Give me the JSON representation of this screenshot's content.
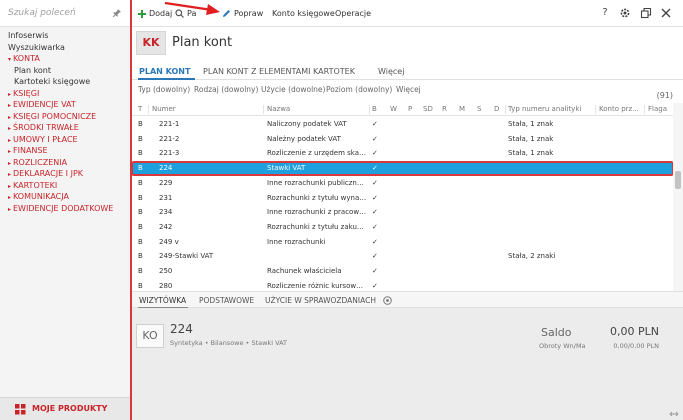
{
  "sidebar": {
    "search_placeholder": "Szukaj poleceń",
    "items": [
      {
        "label": "Infoserwis",
        "style": "normal"
      },
      {
        "label": "Wyszukiwarka",
        "style": "normal"
      },
      {
        "label": "KONTA",
        "style": "red-open"
      },
      {
        "label": "Plan kont",
        "style": "sub"
      },
      {
        "label": "Kartoteki księgowe",
        "style": "sub"
      },
      {
        "label": "KSIĘGI",
        "style": "red"
      },
      {
        "label": "EWIDENCJE VAT",
        "style": "red"
      },
      {
        "label": "KSIĘGI POMOCNICZE",
        "style": "red"
      },
      {
        "label": "ŚRODKI TRWAŁE",
        "style": "red"
      },
      {
        "label": "UMOWY I PŁACE",
        "style": "red"
      },
      {
        "label": "FINANSE",
        "style": "red"
      },
      {
        "label": "ROZLICZENIA",
        "style": "red"
      },
      {
        "label": "DEKLARACJE I JPK",
        "style": "red"
      },
      {
        "label": "KARTOTEKI",
        "style": "red"
      },
      {
        "label": "KOMUNIKACJA",
        "style": "red"
      },
      {
        "label": "EWIDENCJE DODATKOWE",
        "style": "red"
      }
    ],
    "footer_label": "MOJE PRODUKTY"
  },
  "toolbar": {
    "add_label": "Dodaj",
    "search_label": "Pa",
    "edit_label": "Popraw",
    "accounts_label": "Konto księgowe",
    "operations_label": "Operacje",
    "help_label": "?"
  },
  "header": {
    "avatar": "KK",
    "title": "Plan kont"
  },
  "tabs": [
    {
      "label": "PLAN KONT",
      "active": true
    },
    {
      "label": "PLAN KONT Z ELEMENTAMI KARTOTEK",
      "active": false
    },
    {
      "label": "Więcej",
      "active": false
    }
  ],
  "filters": [
    "Typ (dowolny)",
    "Rodzaj (dowolny)",
    "Użycie (dowolne)",
    "Poziom (dowolny)",
    "Więcej"
  ],
  "count": "(91)",
  "table": {
    "columns": [
      "T",
      "Numer",
      "Nazwa",
      "B",
      "W",
      "P",
      "SD",
      "R",
      "M",
      "S",
      "D",
      "Typ numeru analityki",
      "Konto prz...",
      "Flaga"
    ],
    "rows": [
      {
        "t": "B",
        "numer": "221-1",
        "nazwa": "Naliczony podatek VAT",
        "b": "✓",
        "typ": "Stała, 1 znak"
      },
      {
        "t": "B",
        "numer": "221-2",
        "nazwa": "Należny podatek VAT",
        "b": "✓",
        "typ": "Stała, 1 znak"
      },
      {
        "t": "B",
        "numer": "221-3",
        "nazwa": "Rozliczenie z urzędem skar...",
        "b": "✓",
        "typ": "Stała, 1 znak"
      },
      {
        "t": "B",
        "numer": "224",
        "nazwa": "Stawki VAT",
        "b": "✓",
        "typ": "",
        "selected": true
      },
      {
        "t": "B",
        "numer": "229",
        "nazwa": "Inne rozrachunki publiczno...",
        "b": "✓",
        "typ": ""
      },
      {
        "t": "B",
        "numer": "231",
        "nazwa": "Rozrachunki z tytułu wynag...",
        "b": "✓",
        "typ": ""
      },
      {
        "t": "B",
        "numer": "234",
        "nazwa": "Inne rozrachunki z pracown...",
        "b": "✓",
        "typ": ""
      },
      {
        "t": "B",
        "numer": "242",
        "nazwa": "Rozrachunki z tytułu zakup...",
        "b": "✓",
        "typ": ""
      },
      {
        "t": "B",
        "numer": "249 v",
        "nazwa": "Inne rozrachunki",
        "b": "✓",
        "typ": ""
      },
      {
        "t": "B",
        "numer": "249-Stawki VAT",
        "nazwa": "",
        "b": "✓",
        "typ": "Stała, 2 znaki"
      },
      {
        "t": "B",
        "numer": "250",
        "nazwa": "Rachunek właściciela",
        "b": "✓",
        "typ": ""
      },
      {
        "t": "B",
        "numer": "280",
        "nazwa": "Rozliczenie różnic kursowych",
        "b": "✓",
        "typ": "",
        "partial": true
      }
    ]
  },
  "bottom_tabs": [
    {
      "label": "WIZYTÓWKA",
      "active": true
    },
    {
      "label": "PODSTAWOWE",
      "active": false
    },
    {
      "label": "UŻYCIE W SPRAWOZDANIACH",
      "active": false
    }
  ],
  "detail": {
    "badge": "KO",
    "number": "224",
    "meta": "Syntetyka  •  Bilansowe  •  Stawki VAT",
    "saldo_label": "Saldo",
    "saldo_value": "0,00 PLN",
    "obroty_label": "Obroty Wn/Ma",
    "obroty_value": "0,00/0,00 PLN"
  },
  "colors": {
    "accent_red": "#c8242a",
    "selection_blue": "#1ea0de",
    "tab_blue": "#2b78b8"
  }
}
